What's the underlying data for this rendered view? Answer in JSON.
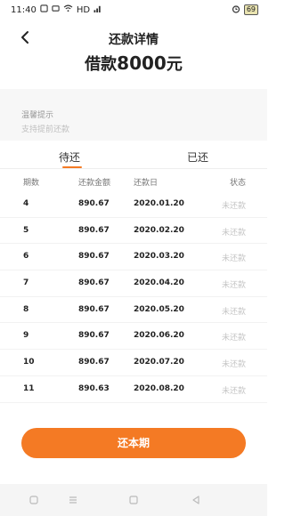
{
  "status_bar": {
    "time": "11:40",
    "signal_text": "HD",
    "battery": "69"
  },
  "header": {
    "title": "还款详情",
    "amount_prefix": "借款",
    "amount_value": "8000",
    "amount_suffix": "元"
  },
  "tip": {
    "title": "温馨提示",
    "text": "支持提前还款"
  },
  "tabs": {
    "pending": "待还",
    "done": "已还"
  },
  "table": {
    "headers": [
      "期数",
      "还款金额",
      "还款日",
      "状态"
    ],
    "rows": [
      {
        "period": "4",
        "amount": "890.67",
        "date": "2020.01.20",
        "status": "未还款"
      },
      {
        "period": "5",
        "amount": "890.67",
        "date": "2020.02.20",
        "status": "未还款"
      },
      {
        "period": "6",
        "amount": "890.67",
        "date": "2020.03.20",
        "status": "未还款"
      },
      {
        "period": "7",
        "amount": "890.67",
        "date": "2020.04.20",
        "status": "未还款"
      },
      {
        "period": "8",
        "amount": "890.67",
        "date": "2020.05.20",
        "status": "未还款"
      },
      {
        "period": "9",
        "amount": "890.67",
        "date": "2020.06.20",
        "status": "未还款"
      },
      {
        "period": "10",
        "amount": "890.67",
        "date": "2020.07.20",
        "status": "未还款"
      },
      {
        "period": "11",
        "amount": "890.63",
        "date": "2020.08.20",
        "status": "未还款"
      }
    ]
  },
  "actions": {
    "repay_label": "还本期"
  },
  "colors": {
    "accent": "#f47a24"
  }
}
